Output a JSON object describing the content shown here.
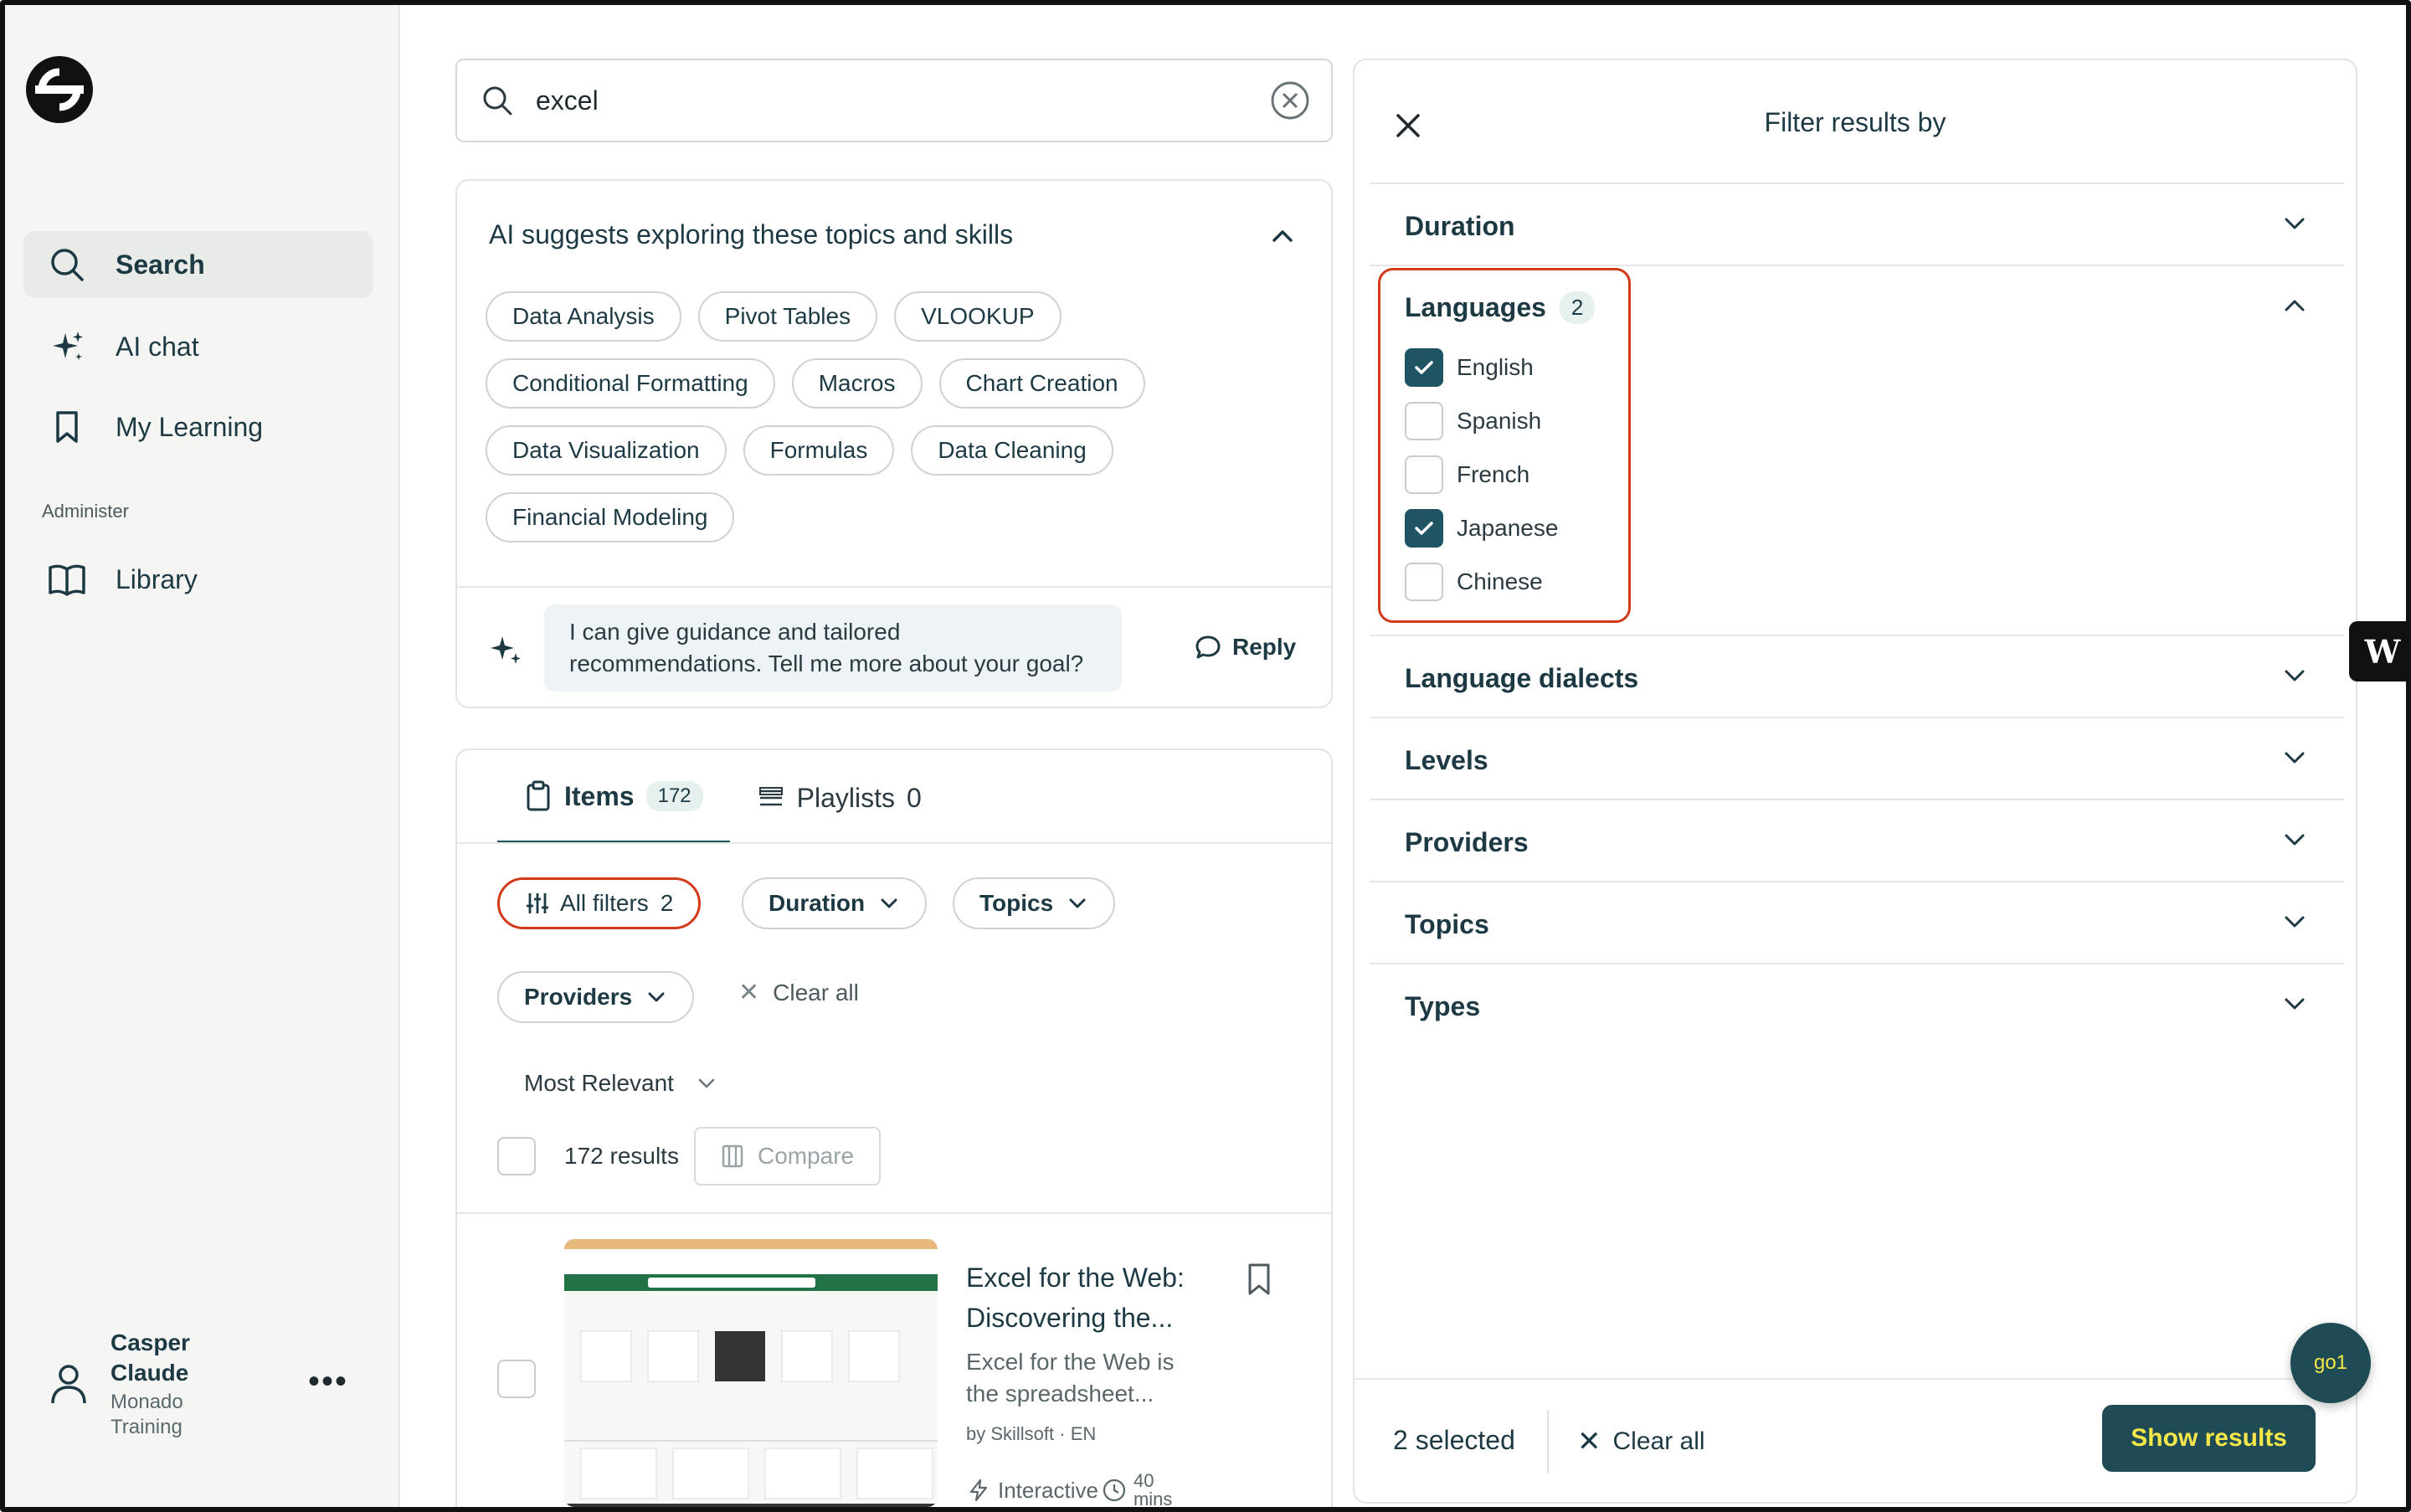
{
  "sidebar": {
    "nav": [
      {
        "label": "Search",
        "icon": "search-icon"
      },
      {
        "label": "AI chat",
        "icon": "sparkle-icon"
      },
      {
        "label": "My Learning",
        "icon": "bookmark-icon"
      }
    ],
    "section_label": "Administer",
    "admin_nav": [
      {
        "label": "Library",
        "icon": "book-open-icon"
      }
    ],
    "user": {
      "name": "Casper Claude",
      "org": "Monado Training",
      "more": "•••"
    }
  },
  "search": {
    "value": "excel",
    "placeholder": ""
  },
  "ai_suggest": {
    "title": "AI suggests exploring these topics and skills",
    "chip_rows": [
      [
        "Data Analysis",
        "Pivot Tables",
        "VLOOKUP"
      ],
      [
        "Conditional Formatting",
        "Macros",
        "Chart Creation"
      ],
      [
        "Data Visualization",
        "Formulas",
        "Data Cleaning"
      ],
      [
        "Financial Modeling"
      ]
    ],
    "message": "I can give guidance and tailored recommendations. Tell me more about your goal?",
    "reply_label": "Reply"
  },
  "results": {
    "tabs": [
      {
        "label": "Items",
        "count": "172"
      },
      {
        "label": "Playlists",
        "count": "0"
      }
    ],
    "filters": {
      "all_filters": "All filters",
      "all_filters_count": "2",
      "duration": "Duration",
      "topics": "Topics",
      "providers": "Providers",
      "clear_all": "Clear all"
    },
    "sort": "Most Relevant",
    "count_label": "172 results",
    "compare_label": "Compare",
    "item": {
      "title": "Excel for the Web: Discovering the...",
      "desc": "Excel for the Web is the spreadsheet...",
      "meta": "by Skillsoft · EN",
      "type": "Interactive",
      "duration": "40 mins"
    }
  },
  "filter_panel": {
    "title": "Filter results by",
    "sections": {
      "duration": "Duration",
      "languages": "Languages",
      "languages_count": "2",
      "dialects": "Language dialects",
      "levels": "Levels",
      "providers": "Providers",
      "topics": "Topics",
      "types": "Types"
    },
    "languages": [
      {
        "label": "English",
        "checked": true
      },
      {
        "label": "Spanish",
        "checked": false
      },
      {
        "label": "French",
        "checked": false
      },
      {
        "label": "Japanese",
        "checked": true
      },
      {
        "label": "Chinese",
        "checked": false
      }
    ],
    "footer": {
      "selected": "2 selected",
      "clear_all": "Clear all",
      "show_results": "Show results"
    }
  },
  "widgets": {
    "w_badge": "W",
    "go_badge": "go1"
  },
  "colors": {
    "accent": "#1f4b55",
    "highlight": "#d4391a",
    "button_text": "#f6e64a"
  }
}
